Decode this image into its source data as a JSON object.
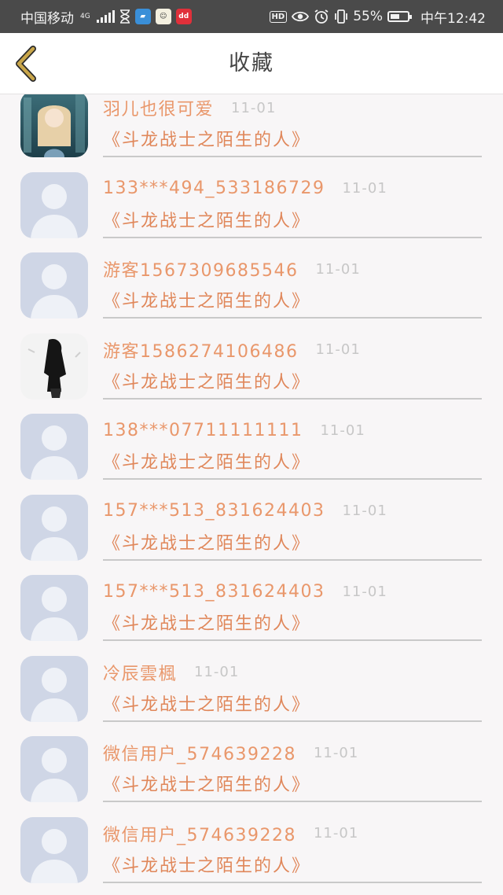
{
  "status_bar": {
    "carrier": "中国移动",
    "network": "4G",
    "battery_text": "55%",
    "battery_level": 0.55,
    "hd_label": "HD",
    "clock": "中午12:42",
    "icons": [
      "hourglass-icon",
      "delivery-app-icon",
      "face-app-icon",
      "red-app-icon",
      "eye-icon",
      "alarm-icon",
      "vibrate-icon",
      "battery-icon"
    ]
  },
  "header": {
    "title": "收藏",
    "back_icon": "chevron-left-icon",
    "accent": "#c9a64a"
  },
  "colors": {
    "name": "#e9976b",
    "work": "#e0875a",
    "date": "#c7c7c7",
    "avatar_default": "#cfd6e6"
  },
  "favorites": [
    {
      "name": "羽儿也很可爱",
      "date": "11-01",
      "work": "《斗龙战士之陌生的人》",
      "avatar": "anime-girl"
    },
    {
      "name": "133***494_533186729",
      "date": "11-01",
      "work": "《斗龙战士之陌生的人》",
      "avatar": "default"
    },
    {
      "name": "游客1567309685546",
      "date": "11-01",
      "work": "《斗龙战士之陌生的人》",
      "avatar": "default"
    },
    {
      "name": "游客1586274106486",
      "date": "11-01",
      "work": "《斗龙战士之陌生的人》",
      "avatar": "silhouette-girl"
    },
    {
      "name": "138***07711111111",
      "date": "11-01",
      "work": "《斗龙战士之陌生的人》",
      "avatar": "default"
    },
    {
      "name": "157***513_831624403",
      "date": "11-01",
      "work": "《斗龙战士之陌生的人》",
      "avatar": "default"
    },
    {
      "name": "157***513_831624403",
      "date": "11-01",
      "work": "《斗龙战士之陌生的人》",
      "avatar": "default"
    },
    {
      "name": "冷辰雲楓",
      "date": "11-01",
      "work": "《斗龙战士之陌生的人》",
      "avatar": "default"
    },
    {
      "name": "微信用户_574639228",
      "date": "11-01",
      "work": "《斗龙战士之陌生的人》",
      "avatar": "default"
    },
    {
      "name": "微信用户_574639228",
      "date": "11-01",
      "work": "《斗龙战士之陌生的人》",
      "avatar": "default"
    }
  ]
}
